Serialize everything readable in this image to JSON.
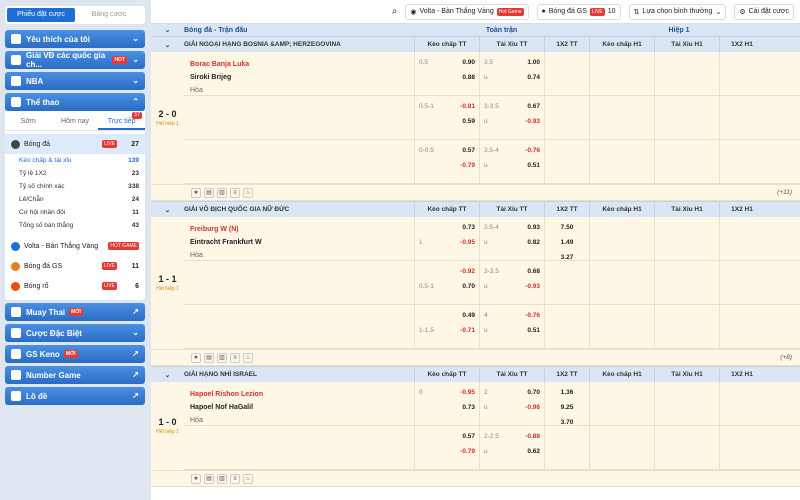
{
  "sidebar": {
    "tabs": [
      "Phiếu đặt cược",
      "Bảng cược"
    ],
    "sections": [
      {
        "label": "Yêu thích của tôi",
        "icon": "star-icon"
      },
      {
        "label": "Giải VĐ các quốc gia ch...",
        "icon": "trophy-icon",
        "badge": "HOT"
      },
      {
        "label": "NBA",
        "icon": "nba-icon"
      },
      {
        "label": "Thể thao",
        "icon": "sports-icon"
      }
    ],
    "subtabs": [
      "Sớm",
      "Hôm nay",
      "Trực tiếp"
    ],
    "live_count": "57",
    "football": {
      "label": "Bóng đá",
      "badge": "LIVE",
      "count": "27"
    },
    "markets": [
      {
        "label": "Kèo chấp & tài xỉu",
        "count": "139"
      },
      {
        "label": "Tỷ lệ 1X2",
        "count": "23"
      },
      {
        "label": "Tỷ số chính xác",
        "count": "338"
      },
      {
        "label": "Lẻ/Chẵn",
        "count": "24"
      },
      {
        "label": "Cơ hội nhân đôi",
        "count": "11"
      },
      {
        "label": "Tổng số bàn thắng",
        "count": "43"
      }
    ],
    "others": [
      {
        "label": "Volta - Bàn Thắng Vàng",
        "badge": "HOT GAME",
        "count": ""
      },
      {
        "label": "Bóng đá GS",
        "badge": "LIVE",
        "count": "11"
      },
      {
        "label": "Bóng rổ",
        "badge": "LIVE",
        "count": "6"
      }
    ],
    "bottom": [
      {
        "label": "Muay Thai",
        "new": "MỚI"
      },
      {
        "label": "Cược Đặc Biệt",
        "new": ""
      },
      {
        "label": "GS Keno",
        "new": "MỚI"
      },
      {
        "label": "Number Game",
        "new": ""
      },
      {
        "label": "Lô đề",
        "new": ""
      }
    ]
  },
  "topbar": {
    "volta": "Volta - Bàn Thắng Vàng",
    "volta_badge": "Hot Game",
    "gs": "Bóng đá GS",
    "gs_badge": "LIVE",
    "gs_count": "10",
    "sort": "Lựa chọn bình thường",
    "settings": "Cài đặt cược"
  },
  "header": {
    "title": "Bóng đá - Trận đấu",
    "full": "Toàn trận",
    "half": "Hiệp 1"
  },
  "cols": [
    "Kèo chấp TT",
    "Tài Xỉu TT",
    "1X2 TT",
    "Kèo chấp H1",
    "Tài Xỉu H1",
    "1X2 H1"
  ],
  "leagues": [
    {
      "name": "GIẢI NGOẠI HẠNG BOSNIA &AMP; HERZEGOVINA",
      "score": "2 - 0",
      "half": "Hết hiệp 1",
      "home": "Borac Banja Luka",
      "away": "Siroki Brijeg",
      "draw": "Hòa",
      "more": "(+11)",
      "rows": [
        {
          "hc": [
            "0.5",
            ""
          ],
          "hv": [
            "0.90",
            "0.88"
          ],
          "ou": [
            "3.5",
            "u"
          ],
          "ov": [
            "1.00",
            "0.74"
          ],
          "x": [
            "",
            "",
            ""
          ]
        },
        {
          "hc": [
            "0.5-1",
            ""
          ],
          "hv": [
            "-0.81",
            "0.59"
          ],
          "ou": [
            "3-3.5",
            "u"
          ],
          "ov": [
            "0.67",
            "-0.93"
          ],
          "x": [
            "",
            "",
            ""
          ]
        },
        {
          "hc": [
            "0-0.5",
            ""
          ],
          "hv": [
            "0.57",
            "-0.79"
          ],
          "ou": [
            "3.5-4",
            "u"
          ],
          "ov": [
            "-0.76",
            "0.51"
          ],
          "x": [
            "",
            "",
            ""
          ]
        }
      ]
    },
    {
      "name": "GIẢI VÔ ĐỊCH QUỐC GIA NỮ ĐỨC",
      "score": "1 - 1",
      "half": "Hết hiệp 1",
      "home": "Freiburg W (N)",
      "away": "Eintracht Frankfurt W",
      "draw": "Hòa",
      "more": "(+8)",
      "rows": [
        {
          "hc": [
            "",
            "1"
          ],
          "hv": [
            "0.73",
            "-0.95"
          ],
          "ou": [
            "3.5-4",
            "u"
          ],
          "ov": [
            "0.93",
            "0.82"
          ],
          "x": [
            "7.50",
            "1.49",
            "3.27"
          ]
        },
        {
          "hc": [
            "",
            "0.5-1"
          ],
          "hv": [
            "-0.92",
            "0.70"
          ],
          "ou": [
            "3-3.5",
            "u"
          ],
          "ov": [
            "0.68",
            "-0.93"
          ],
          "x": [
            "",
            "",
            ""
          ]
        },
        {
          "hc": [
            "",
            "1-1.5"
          ],
          "hv": [
            "0.49",
            "-0.71"
          ],
          "ou": [
            "4",
            "u"
          ],
          "ov": [
            "-0.76",
            "0.51"
          ],
          "x": [
            "",
            "",
            ""
          ]
        }
      ]
    },
    {
      "name": "GIẢI HẠNG NHÌ ISRAEL",
      "score": "1 - 0",
      "half": "Hết hiệp 1",
      "home": "Hapoel Rishon Lezion",
      "away": "Hapoel Nof HaGalil",
      "draw": "Hòa",
      "more": "",
      "rows": [
        {
          "hc": [
            "0",
            ""
          ],
          "hv": [
            "-0.95",
            "0.73"
          ],
          "ou": [
            "2",
            "u"
          ],
          "ov": [
            "0.70",
            "-0.96"
          ],
          "x": [
            "1.36",
            "9.25",
            "3.70"
          ]
        },
        {
          "hc": [
            "",
            ""
          ],
          "hv": [
            "0.57",
            "-0.79"
          ],
          "ou": [
            "2-2.5",
            "u"
          ],
          "ov": [
            "-0.88",
            "0.62"
          ],
          "x": [
            "",
            "",
            ""
          ]
        }
      ]
    }
  ]
}
